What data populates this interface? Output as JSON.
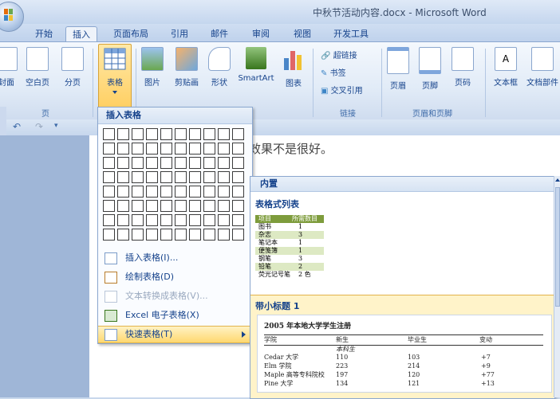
{
  "window": {
    "title": "中秋节活动内容.docx - Microsoft Word"
  },
  "tabs": [
    {
      "label": "开始"
    },
    {
      "label": "插入"
    },
    {
      "label": "页面布局"
    },
    {
      "label": "引用"
    },
    {
      "label": "邮件"
    },
    {
      "label": "审阅"
    },
    {
      "label": "视图"
    },
    {
      "label": "开发工具"
    }
  ],
  "ribbon": {
    "pages": {
      "cover": "封面",
      "blank": "空白页",
      "break": "分页",
      "label": "页"
    },
    "table": {
      "label": "表格"
    },
    "illustrations": {
      "picture": "图片",
      "clipart": "剪贴画",
      "shapes": "形状",
      "smartart": "SmartArt",
      "chart": "图表"
    },
    "links": {
      "hyperlink": "超链接",
      "bookmark": "书签",
      "crossref": "交叉引用",
      "label": "链接"
    },
    "header_footer": {
      "header": "页眉",
      "footer": "页脚",
      "page_number": "页码",
      "label": "页眉和页脚"
    },
    "text": {
      "textbox": "文本框",
      "quickparts": "文档部件"
    }
  },
  "document": {
    "text_fragment": "效果不是很好。"
  },
  "table_menu": {
    "title": "插入表格",
    "grid_columns": 10,
    "grid_rows": 8,
    "items": [
      {
        "label": "插入表格(I)...",
        "enabled": true
      },
      {
        "label": "绘制表格(D)",
        "enabled": true
      },
      {
        "label": "文本转换成表格(V)...",
        "enabled": false
      },
      {
        "label": "Excel 电子表格(X)",
        "enabled": true
      },
      {
        "label": "快速表格(T)",
        "enabled": true,
        "highlighted": true
      }
    ]
  },
  "quick_tables": {
    "header": "内置",
    "sections": [
      {
        "title": "表格式列表",
        "preview": {
          "headers": [
            "项目",
            "所需数目"
          ],
          "rows": [
            [
              "图书",
              "1"
            ],
            [
              "杂志",
              "3"
            ],
            [
              "笔记本",
              "1"
            ],
            [
              "便笺簿",
              "1"
            ],
            [
              "钢笔",
              "3"
            ],
            [
              "铅笔",
              "2"
            ],
            [
              "荧光记号笔",
              "2 色"
            ]
          ]
        }
      },
      {
        "title": "带小标题 1",
        "preview": {
          "title": "2005 年本地大学学生注册",
          "headers": [
            "学院",
            "新生",
            "毕业生",
            "变动"
          ],
          "subheader": "本科生",
          "rows": [
            [
              "Cedar 大学",
              "110",
              "103",
              "+7"
            ],
            [
              "Elm 学院",
              "223",
              "214",
              "+9"
            ],
            [
              "Maple 高等专科院校",
              "197",
              "120",
              "+77"
            ],
            [
              "Pine 大学",
              "134",
              "121",
              "+13"
            ]
          ]
        }
      }
    ]
  }
}
